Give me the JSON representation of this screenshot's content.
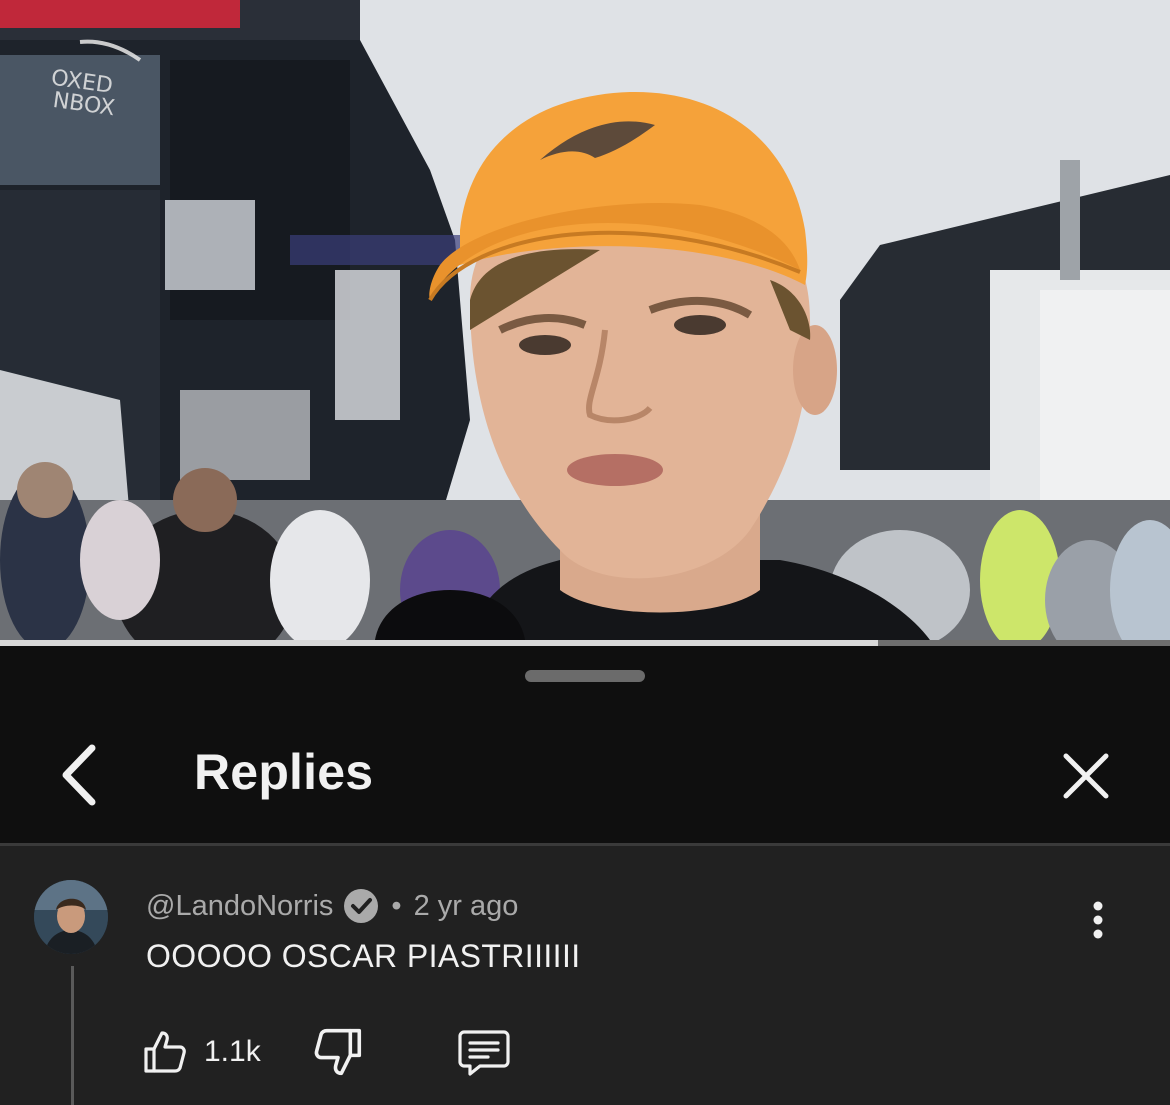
{
  "video": {
    "progress_fraction": 0.75,
    "overlay_logo_icon": "channel-watermark-icon"
  },
  "sheet": {
    "title": "Replies",
    "back_icon": "chevron-left-icon",
    "close_icon": "close-icon"
  },
  "comment": {
    "author": "@LandoNorris",
    "verified_icon": "verified-check-icon",
    "separator": "•",
    "time": "2 yr ago",
    "text": "OOOOO OSCAR PIASTRIIIIII",
    "like_count": "1.1k",
    "like_icon": "thumbs-up-icon",
    "dislike_icon": "thumbs-down-icon",
    "reply_icon": "reply-comment-icon",
    "more_icon": "more-vertical-icon"
  },
  "colors": {
    "sheet_bg": "#0f0f0f",
    "comment_bg": "#212121",
    "text_primary": "#f1f1f1",
    "text_secondary": "#aaaaaa",
    "cap_orange": "#f5a23a"
  }
}
